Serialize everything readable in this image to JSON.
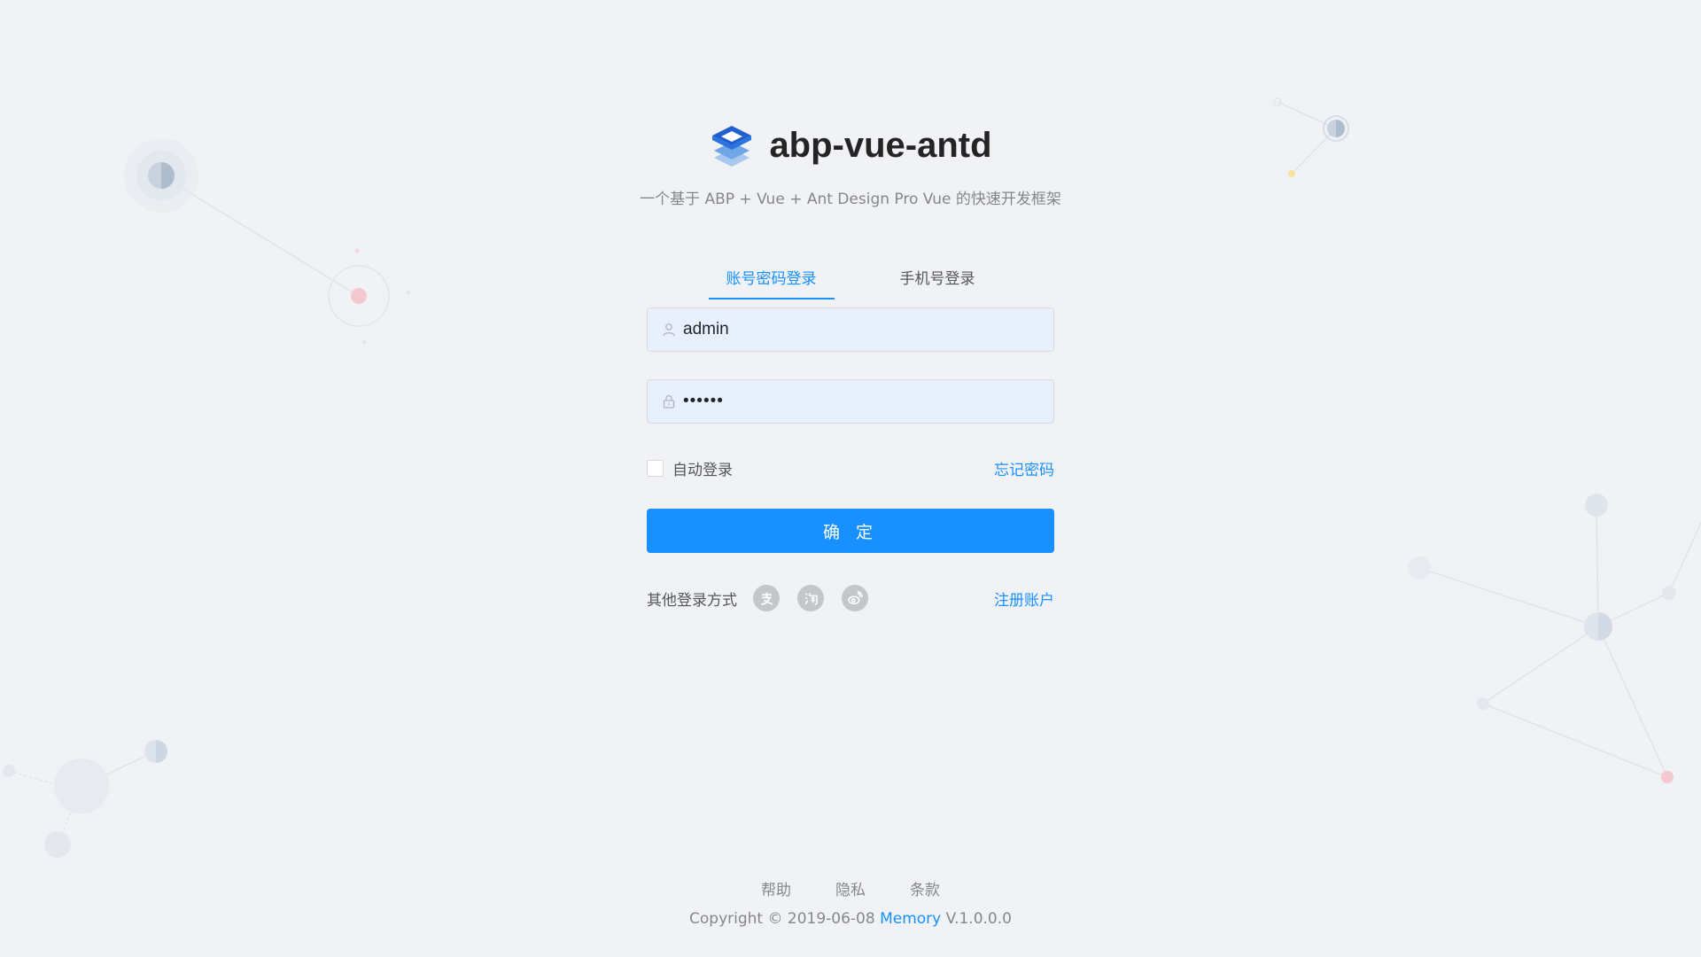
{
  "app": {
    "title": "abp-vue-antd",
    "description": "一个基于 ABP + Vue + Ant Design Pro Vue 的快速开发框架"
  },
  "tabs": [
    {
      "label": "账号密码登录",
      "active": true
    },
    {
      "label": "手机号登录",
      "active": false
    }
  ],
  "form": {
    "username_value": "admin",
    "password_value": "123456",
    "remember_label": "自动登录",
    "remember_checked": false,
    "forgot_label": "忘记密码",
    "submit_label": "确 定"
  },
  "other_login": {
    "label": "其他登录方式",
    "icons": [
      "alipay-icon",
      "taobao-icon",
      "weibo-icon"
    ],
    "register_label": "注册账户"
  },
  "footer": {
    "links": [
      "帮助",
      "隐私",
      "条款"
    ],
    "copyright_prefix": "Copyright © 2019-06-08",
    "author": "Memory",
    "version": "V.1.0.0.0"
  },
  "colors": {
    "primary": "#1890ff",
    "background": "#f0f2f5",
    "autofill": "#e8f0fe"
  }
}
